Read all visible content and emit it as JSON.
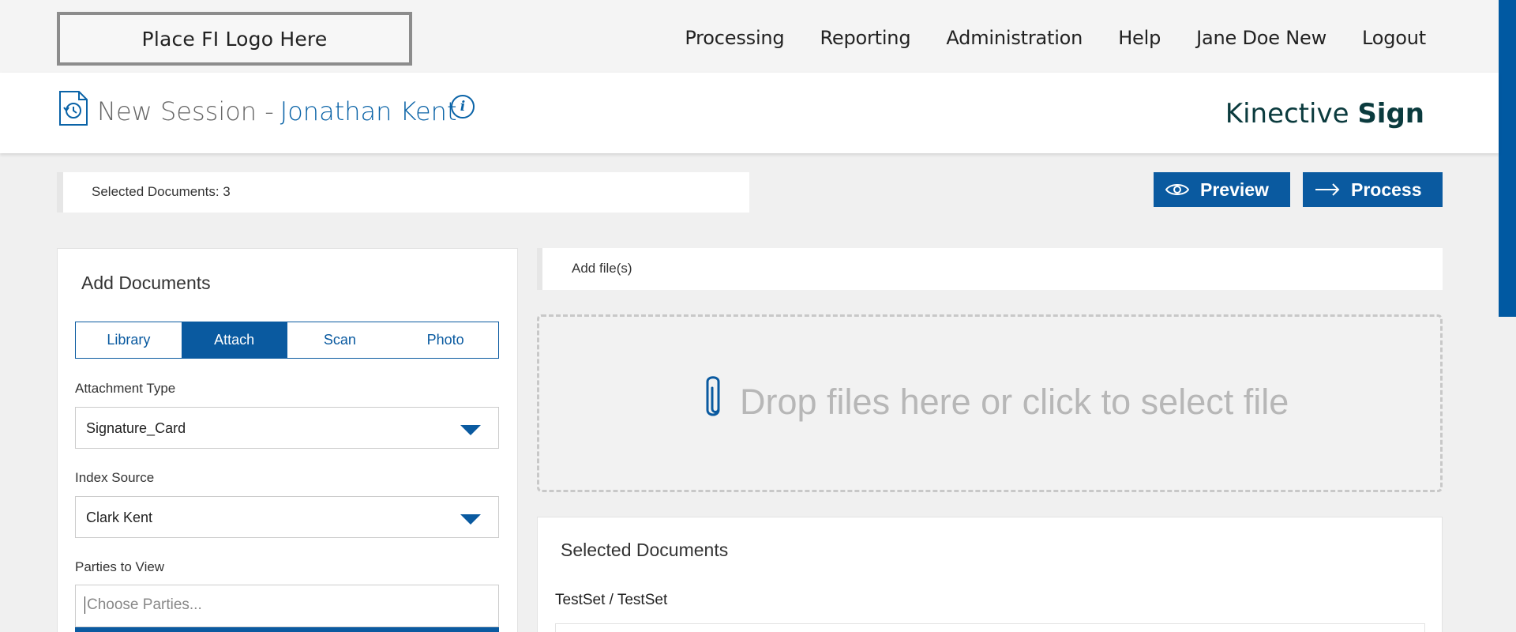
{
  "topbar": {
    "logo_text": "Place FI Logo Here",
    "nav": [
      "Processing",
      "Reporting",
      "Administration",
      "Help",
      "Jane Doe New",
      "Logout"
    ]
  },
  "session": {
    "title_prefix": "New Session -",
    "customer_name": "Jonathan Kent",
    "info_glyph": "i",
    "brand_light": "Kinective",
    "brand_bold": "Sign"
  },
  "toolbar": {
    "selected_count_text": "Selected Documents: 3",
    "preview_label": "Preview",
    "process_label": "Process"
  },
  "add_documents": {
    "title": "Add Documents",
    "tabs": [
      "Library",
      "Attach",
      "Scan",
      "Photo"
    ],
    "active_tab": "Attach",
    "attachment_type_label": "Attachment Type",
    "attachment_type_value": "Signature_Card",
    "index_source_label": "Index Source",
    "index_source_value": "Clark Kent",
    "parties_label": "Parties to View",
    "parties_placeholder": "Choose Parties..."
  },
  "files": {
    "add_files_label": "Add file(s)",
    "dropzone_text": "Drop files here or click to select file"
  },
  "selected_documents": {
    "title": "Selected Documents",
    "set_name": "TestSet / TestSet"
  },
  "icons": {
    "history": "history-document-icon",
    "info": "info-icon",
    "eye": "eye-icon",
    "arrow": "arrow-right-icon",
    "paperclip": "paperclip-icon",
    "caret": "chevron-down-icon"
  },
  "colors": {
    "accent": "#0a5aa0",
    "brand_text": "#0b3b3e",
    "background": "#f0f0f0"
  }
}
